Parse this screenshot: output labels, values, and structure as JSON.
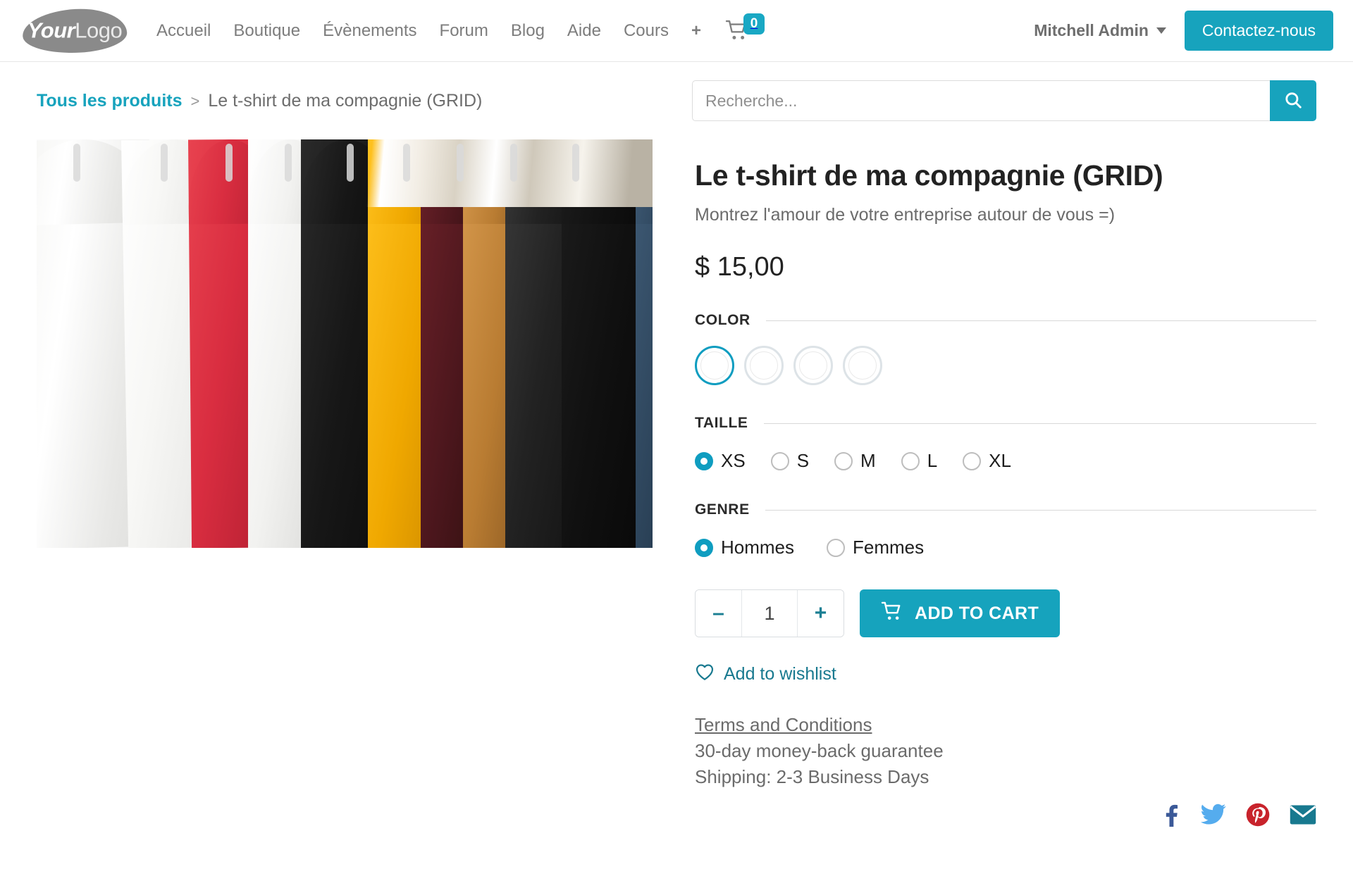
{
  "header": {
    "logo": {
      "part1": "Your",
      "part2": "Logo",
      "name": "YourLogo"
    },
    "nav": [
      {
        "label": "Accueil"
      },
      {
        "label": "Boutique"
      },
      {
        "label": "Évènements"
      },
      {
        "label": "Forum"
      },
      {
        "label": "Blog"
      },
      {
        "label": "Aide"
      },
      {
        "label": "Cours"
      }
    ],
    "add_label": "+",
    "cart": {
      "icon": "shopping-cart-icon",
      "count": "0"
    },
    "user": {
      "name": "Mitchell Admin",
      "caret": "chevron-down-icon"
    },
    "contact_button": "Contactez-nous"
  },
  "breadcrumb": {
    "root": "Tous les produits",
    "separator": ">",
    "current": "Le t-shirt de ma compagnie (GRID)"
  },
  "search": {
    "placeholder": "Recherche...",
    "value": "",
    "icon": "search-icon"
  },
  "product": {
    "image_alt": "t-shirts hanging on a clothing rack",
    "title": "Le t-shirt de ma compagnie (GRID)",
    "subtitle": "Montrez l'amour de votre entreprise autour de vous =)",
    "price": "$ 15,00"
  },
  "attributes": {
    "color": {
      "label": "COLOR",
      "options": [
        {
          "name": "swatch-1",
          "selected": true
        },
        {
          "name": "swatch-2",
          "selected": false
        },
        {
          "name": "swatch-3",
          "selected": false
        },
        {
          "name": "swatch-4",
          "selected": false
        }
      ]
    },
    "size": {
      "label": "TAILLE",
      "options": [
        {
          "label": "XS",
          "selected": true
        },
        {
          "label": "S",
          "selected": false
        },
        {
          "label": "M",
          "selected": false
        },
        {
          "label": "L",
          "selected": false
        },
        {
          "label": "XL",
          "selected": false
        }
      ]
    },
    "gender": {
      "label": "GENRE",
      "options": [
        {
          "label": "Hommes",
          "selected": true
        },
        {
          "label": "Femmes",
          "selected": false
        }
      ]
    }
  },
  "purchase": {
    "minus": "–",
    "plus": "+",
    "quantity": "1",
    "add_to_cart": "ADD TO CART",
    "cart_icon": "shopping-cart-icon",
    "wishlist": "Add to wishlist",
    "wishlist_icon": "heart-icon"
  },
  "terms": {
    "link": "Terms and Conditions",
    "line1": "30-day money-back guarantee",
    "line2": "Shipping: 2-3 Business Days"
  },
  "social": [
    {
      "name": "facebook-icon",
      "color": "#3b5998"
    },
    {
      "name": "twitter-icon",
      "color": "#55acee"
    },
    {
      "name": "pinterest-icon",
      "color": "#c8232c"
    },
    {
      "name": "email-icon",
      "color": "#18798f"
    }
  ],
  "theme": {
    "accent": "#17a3bd",
    "accent_dark": "#18798f",
    "text": "#3c3c3c",
    "muted": "#6b6b6b"
  }
}
